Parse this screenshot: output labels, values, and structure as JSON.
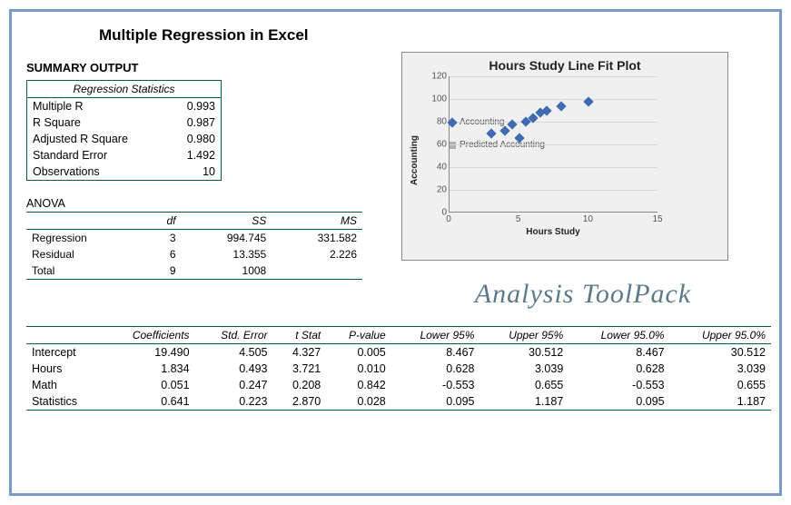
{
  "main_title": "Multiple Regression in Excel",
  "summary_label": "SUMMARY OUTPUT",
  "reg_stats": {
    "header": "Regression Statistics",
    "rows": [
      {
        "label": "Multiple R",
        "value": "0.993"
      },
      {
        "label": "R Square",
        "value": "0.987"
      },
      {
        "label": "Adjusted R Square",
        "value": "0.980"
      },
      {
        "label": "Standard Error",
        "value": "1.492"
      },
      {
        "label": "Observations",
        "value": "10"
      }
    ]
  },
  "anova_label": "ANOVA",
  "anova": {
    "headers": [
      "",
      "df",
      "SS",
      "MS"
    ],
    "rows": [
      {
        "name": "Regression",
        "df": "3",
        "ss": "994.745",
        "ms": "331.582"
      },
      {
        "name": "Residual",
        "df": "6",
        "ss": "13.355",
        "ms": "2.226"
      },
      {
        "name": "Total",
        "df": "9",
        "ss": "1008",
        "ms": ""
      }
    ]
  },
  "coef": {
    "headers": [
      "",
      "Coefficients",
      "Std. Error",
      "t Stat",
      "P-value",
      "Lower 95%",
      "Upper 95%",
      "Lower 95.0%",
      "Upper 95.0%"
    ],
    "rows": [
      {
        "name": "Intercept",
        "c": "19.490",
        "se": "4.505",
        "t": "4.327",
        "p": "0.005",
        "l95": "8.467",
        "u95": "30.512",
        "l95b": "8.467",
        "u95b": "30.512"
      },
      {
        "name": "Hours",
        "c": "1.834",
        "se": "0.493",
        "t": "3.721",
        "p": "0.010",
        "l95": "0.628",
        "u95": "3.039",
        "l95b": "0.628",
        "u95b": "3.039"
      },
      {
        "name": "Math",
        "c": "0.051",
        "se": "0.247",
        "t": "0.208",
        "p": "0.842",
        "l95": "-0.553",
        "u95": "0.655",
        "l95b": "-0.553",
        "u95b": "0.655"
      },
      {
        "name": "Statistics",
        "c": "0.641",
        "se": "0.223",
        "t": "2.870",
        "p": "0.028",
        "l95": "0.095",
        "u95": "1.187",
        "l95b": "0.095",
        "u95b": "1.187"
      }
    ]
  },
  "chart_data": {
    "type": "scatter",
    "title": "Hours Study Line Fit  Plot",
    "xlabel": "Hours Study",
    "ylabel": "Accounting",
    "xlim": [
      0,
      15
    ],
    "ylim": [
      0,
      120
    ],
    "x_ticks": [
      0,
      5,
      10,
      15
    ],
    "y_ticks": [
      0,
      20,
      40,
      60,
      80,
      100,
      120
    ],
    "series": [
      {
        "name": "Accounting",
        "marker": "diamond",
        "color": "#3e6bb2",
        "points": [
          {
            "x": 3,
            "y": 70
          },
          {
            "x": 4,
            "y": 72
          },
          {
            "x": 4.5,
            "y": 78
          },
          {
            "x": 5,
            "y": 66
          },
          {
            "x": 5.5,
            "y": 80
          },
          {
            "x": 6,
            "y": 83
          },
          {
            "x": 6.5,
            "y": 88
          },
          {
            "x": 7,
            "y": 90
          },
          {
            "x": 8,
            "y": 94
          },
          {
            "x": 10,
            "y": 98
          }
        ]
      },
      {
        "name": "Predicted Accounting",
        "marker": "square",
        "color": "#b0b0b0",
        "points": []
      }
    ]
  },
  "toolpack_label": "Analysis ToolPack"
}
